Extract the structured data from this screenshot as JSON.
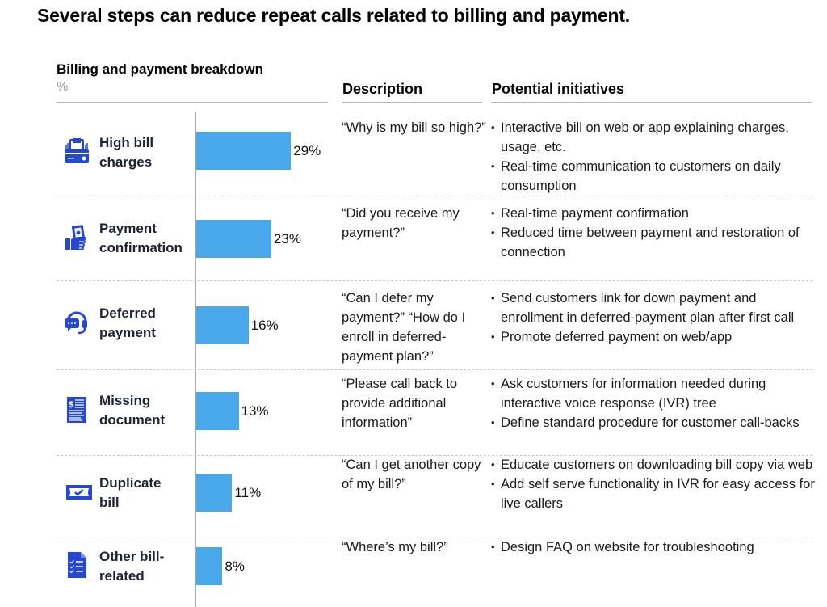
{
  "title": "Several steps can reduce repeat calls related to billing and payment.",
  "colors": {
    "bar": "#48a8ea",
    "icon": "#2447d6",
    "axis": "#a8a8a8"
  },
  "headers": {
    "chart_title": "Billing and payment breakdown",
    "unit": "%",
    "description": "Description",
    "initiatives": "Potential initiatives"
  },
  "rows": [
    {
      "icon": "credit-card-icon",
      "label": "High bill charges",
      "value_label": "29%",
      "description": "“Why is my bill so high?”",
      "initiatives": [
        "Interactive bill on web or app explaining charges, usage, etc.",
        "Real-time communication to customers on daily consumption"
      ]
    },
    {
      "icon": "hand-cash-icon",
      "label": "Payment confirmation",
      "value_label": "23%",
      "description": "“Did you receive my payment?”",
      "initiatives": [
        "Real-time payment confirmation",
        "Reduced time between payment and restoration of connection"
      ]
    },
    {
      "icon": "headset-chat-icon",
      "label": "Deferred payment",
      "value_label": "16%",
      "description": "“Can I defer my payment?” “How do I enroll in  deferred-payment plan?”",
      "initiatives": [
        "Send customers link for down payment and enrollment in deferred-payment plan after first call",
        "Promote deferred payment on web/app"
      ]
    },
    {
      "icon": "receipt-icon",
      "label": "Missing document",
      "value_label": "13%",
      "description": "“Please call back to provide additional information”",
      "initiatives": [
        "Ask customers for information needed during interactive voice response (IVR) tree",
        "Define standard procedure for customer call-backs"
      ]
    },
    {
      "icon": "ticket-check-icon",
      "label": "Duplicate bill",
      "value_label": "11%",
      "description": "“Can I get another copy of my bill?”",
      "initiatives": [
        "Educate customers on downloading bill copy via web",
        "Add self serve functionality in IVR for easy access for live callers"
      ]
    },
    {
      "icon": "checklist-document-icon",
      "label": "Other bill-related",
      "value_label": "8%",
      "description": "“Where’s my bill?”",
      "initiatives": [
        "Design FAQ on website for troubleshooting"
      ]
    }
  ],
  "chart_data": {
    "type": "bar",
    "orientation": "horizontal",
    "title": "Billing and payment breakdown",
    "xlabel": "",
    "ylabel": "",
    "unit": "%",
    "categories": [
      "High bill charges",
      "Payment confirmation",
      "Deferred payment",
      "Missing document",
      "Duplicate bill",
      "Other bill-related"
    ],
    "values": [
      29,
      23,
      16,
      13,
      11,
      8
    ],
    "data_labels": [
      "29%",
      "23%",
      "16%",
      "13%",
      "11%",
      "8%"
    ],
    "xlim": [
      0,
      29
    ],
    "grid": false,
    "legend": "none"
  }
}
